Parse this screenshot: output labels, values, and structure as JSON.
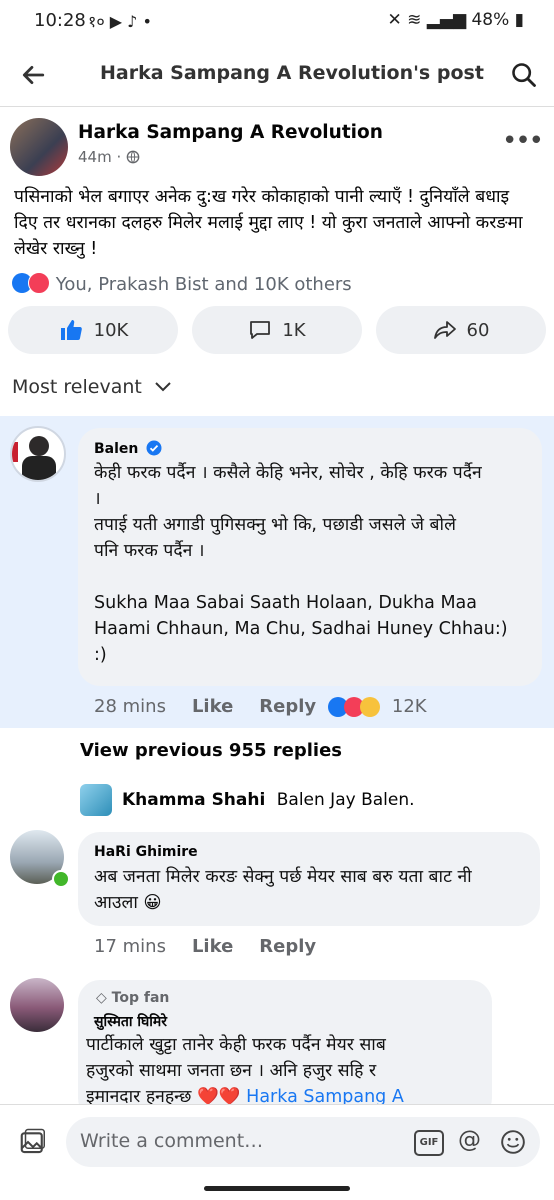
{
  "status_bar": {
    "time": "10:28",
    "sim_label": "१०",
    "battery": "48%"
  },
  "header": {
    "title": "Harka Sampang A Revolution's post"
  },
  "post": {
    "author": "Harka Sampang A Revolution",
    "time": "44m",
    "text": "पसिनाको भेल बगाएर अनेक दु:ख गरेर कोकाहाको पानी ल्याएँ ! दुनियाँले बधाइ दिए तर धरानका दलहरु मिलेर मलाई मुद्दा लाए ! यो कुरा जनताले आफ्नो करङमा लेखेर राख्नु !",
    "reactions_summary": "You, Prakash Bist and 10K others",
    "like_count": "10K",
    "comment_count": "1K",
    "share_count": "60"
  },
  "sort_label": "Most relevant",
  "comments": [
    {
      "name": "Balen",
      "lines": [
        "केही फरक पर्दैन । कसैले केहि भनेर, सोचेर , केहि फरक पर्दैन",
        "।",
        "तपाई यती अगाडी पुगिसक्नु भो कि, पछाडी जसले जे बोले",
        "पनि फरक पर्दैन ।",
        "",
        "Sukha Maa Sabai Saath Holaan, Dukha Maa",
        "Haami Chhaun, Ma Chu, Sadhai Huney Chhau:)",
        ":)"
      ],
      "time": "28 mins",
      "like": "Like",
      "reply": "Reply",
      "reaction_count": "12K"
    },
    {
      "name": "HaRi Ghimire",
      "lines": [
        "अब जनता मिलेर करङ सेक्नु पर्छ मेयर साब बरु यता बाट नी",
        "आउला 😀"
      ],
      "time": "17 mins",
      "like": "Like",
      "reply": "Reply"
    },
    {
      "badge": "Top fan",
      "name": "सुस्मिता घिमिरे",
      "lines": [
        "पार्टीकाले खुट्टा तानेर केही   फरक पर्दैन   मेयर साब",
        "हजुरको साथमा जनता  छन । अनि हजुर  सहि र",
        "इमानदार  हनहन्छ"
      ],
      "mention": "Harka Sampang A"
    }
  ],
  "view_previous": "View previous 955 replies",
  "reply_preview": {
    "name": "Khamma Shahi",
    "text": "Balen Jay Balen."
  },
  "composer": {
    "placeholder": "Write a comment…",
    "gif_label": "GIF"
  },
  "colors": {
    "accent": "#1877f2",
    "highlight_bg": "#e7f0fd",
    "bubble_bg": "#f0f2f5",
    "love": "#f33e58"
  }
}
